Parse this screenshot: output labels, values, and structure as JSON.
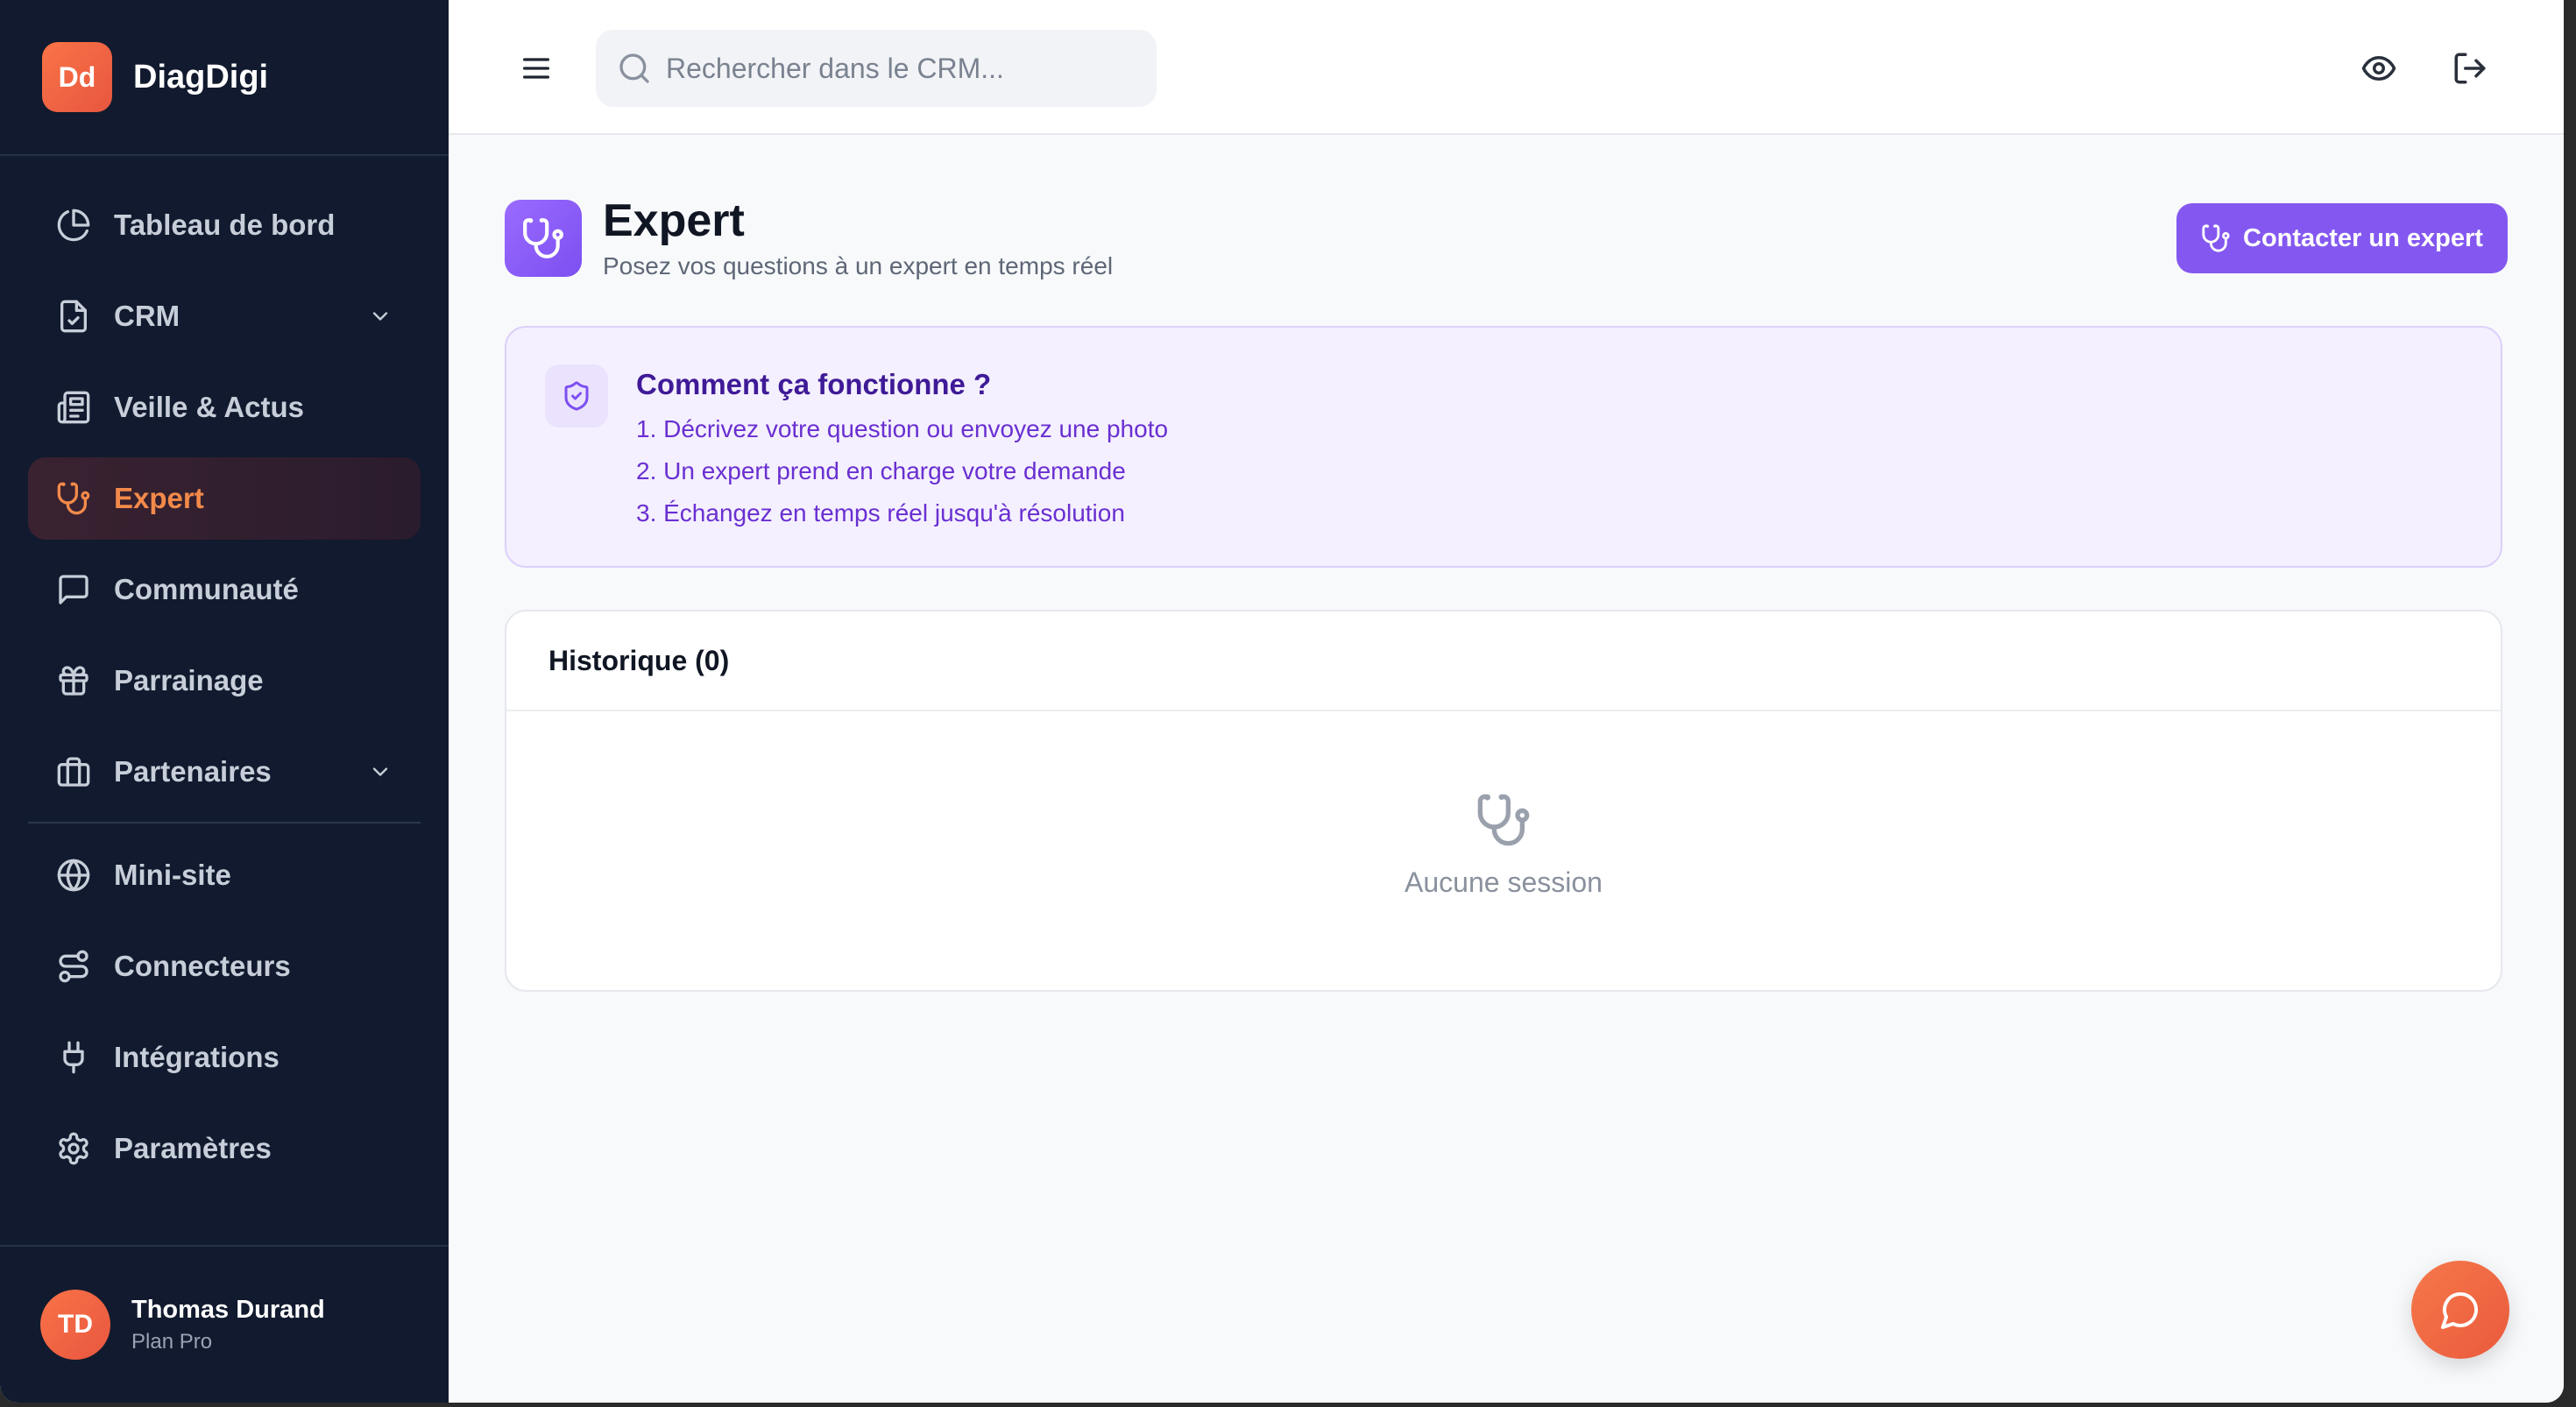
{
  "brand": {
    "logo_text": "Dd",
    "name": "DiagDigi"
  },
  "sidebar": {
    "items": [
      {
        "label": "Tableau de bord",
        "icon": "pie-chart-icon"
      },
      {
        "label": "CRM",
        "icon": "file-check-icon",
        "has_submenu": true
      },
      {
        "label": "Veille & Actus",
        "icon": "newspaper-icon"
      },
      {
        "label": "Expert",
        "icon": "stethoscope-icon",
        "active": true
      },
      {
        "label": "Communauté",
        "icon": "message-square-icon"
      },
      {
        "label": "Parrainage",
        "icon": "gift-icon"
      },
      {
        "label": "Partenaires",
        "icon": "briefcase-icon",
        "has_submenu": true
      }
    ],
    "items_bottom": [
      {
        "label": "Mini-site",
        "icon": "globe-icon"
      },
      {
        "label": "Connecteurs",
        "icon": "route-icon"
      },
      {
        "label": "Intégrations",
        "icon": "plug-icon"
      },
      {
        "label": "Paramètres",
        "icon": "gear-icon"
      }
    ]
  },
  "user": {
    "initials": "TD",
    "name": "Thomas Durand",
    "plan": "Plan Pro"
  },
  "search": {
    "placeholder": "Rechercher dans le CRM..."
  },
  "page": {
    "title": "Expert",
    "subtitle": "Posez vos questions à un expert en temps réel",
    "contact_button": "Contacter un expert"
  },
  "info": {
    "title": "Comment ça fonctionne ?",
    "steps": [
      "1. Décrivez votre question ou envoyez une photo",
      "2. Un expert prend en charge votre demande",
      "3. Échangez en temps réel jusqu'à résolution"
    ]
  },
  "history": {
    "title": "Historique (0)",
    "empty_text": "Aucune session"
  },
  "colors": {
    "sidebar_bg": "#111a2e",
    "accent_orange": "#f38a4a",
    "accent_purple": "#8458f0",
    "info_bg": "#f4f0ff"
  }
}
